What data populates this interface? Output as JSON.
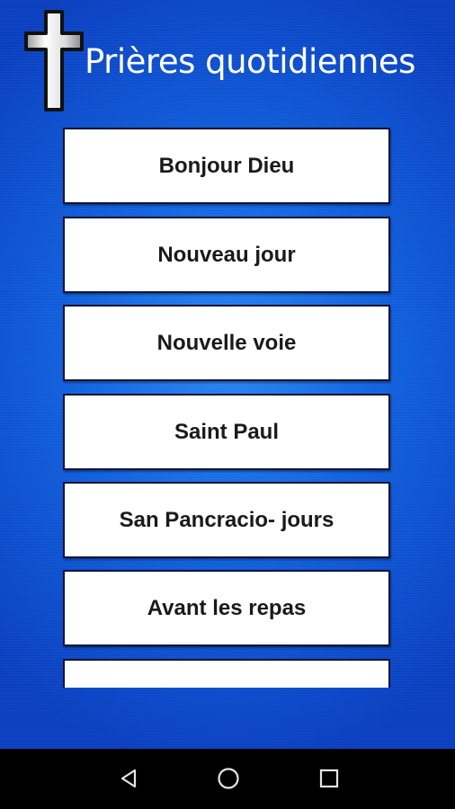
{
  "header": {
    "title": "Prières quotidiennes",
    "icon": "cross-icon"
  },
  "prayers": [
    {
      "label": "Bonjour Dieu"
    },
    {
      "label": "Nouveau jour"
    },
    {
      "label": "Nouvelle voie"
    },
    {
      "label": "Saint Paul"
    },
    {
      "label": "San Pancracio- jours"
    },
    {
      "label": "Avant les repas"
    },
    {
      "label": ""
    }
  ],
  "navbar": {
    "icons": [
      "back-icon",
      "home-icon",
      "recents-icon"
    ]
  },
  "colors": {
    "background_center": "#2a86f2",
    "background_edge": "#0a3fbf",
    "item_background": "#ffffff",
    "item_border": "#0c1433",
    "title_text": "#ffffff",
    "navbar": "#000000"
  }
}
